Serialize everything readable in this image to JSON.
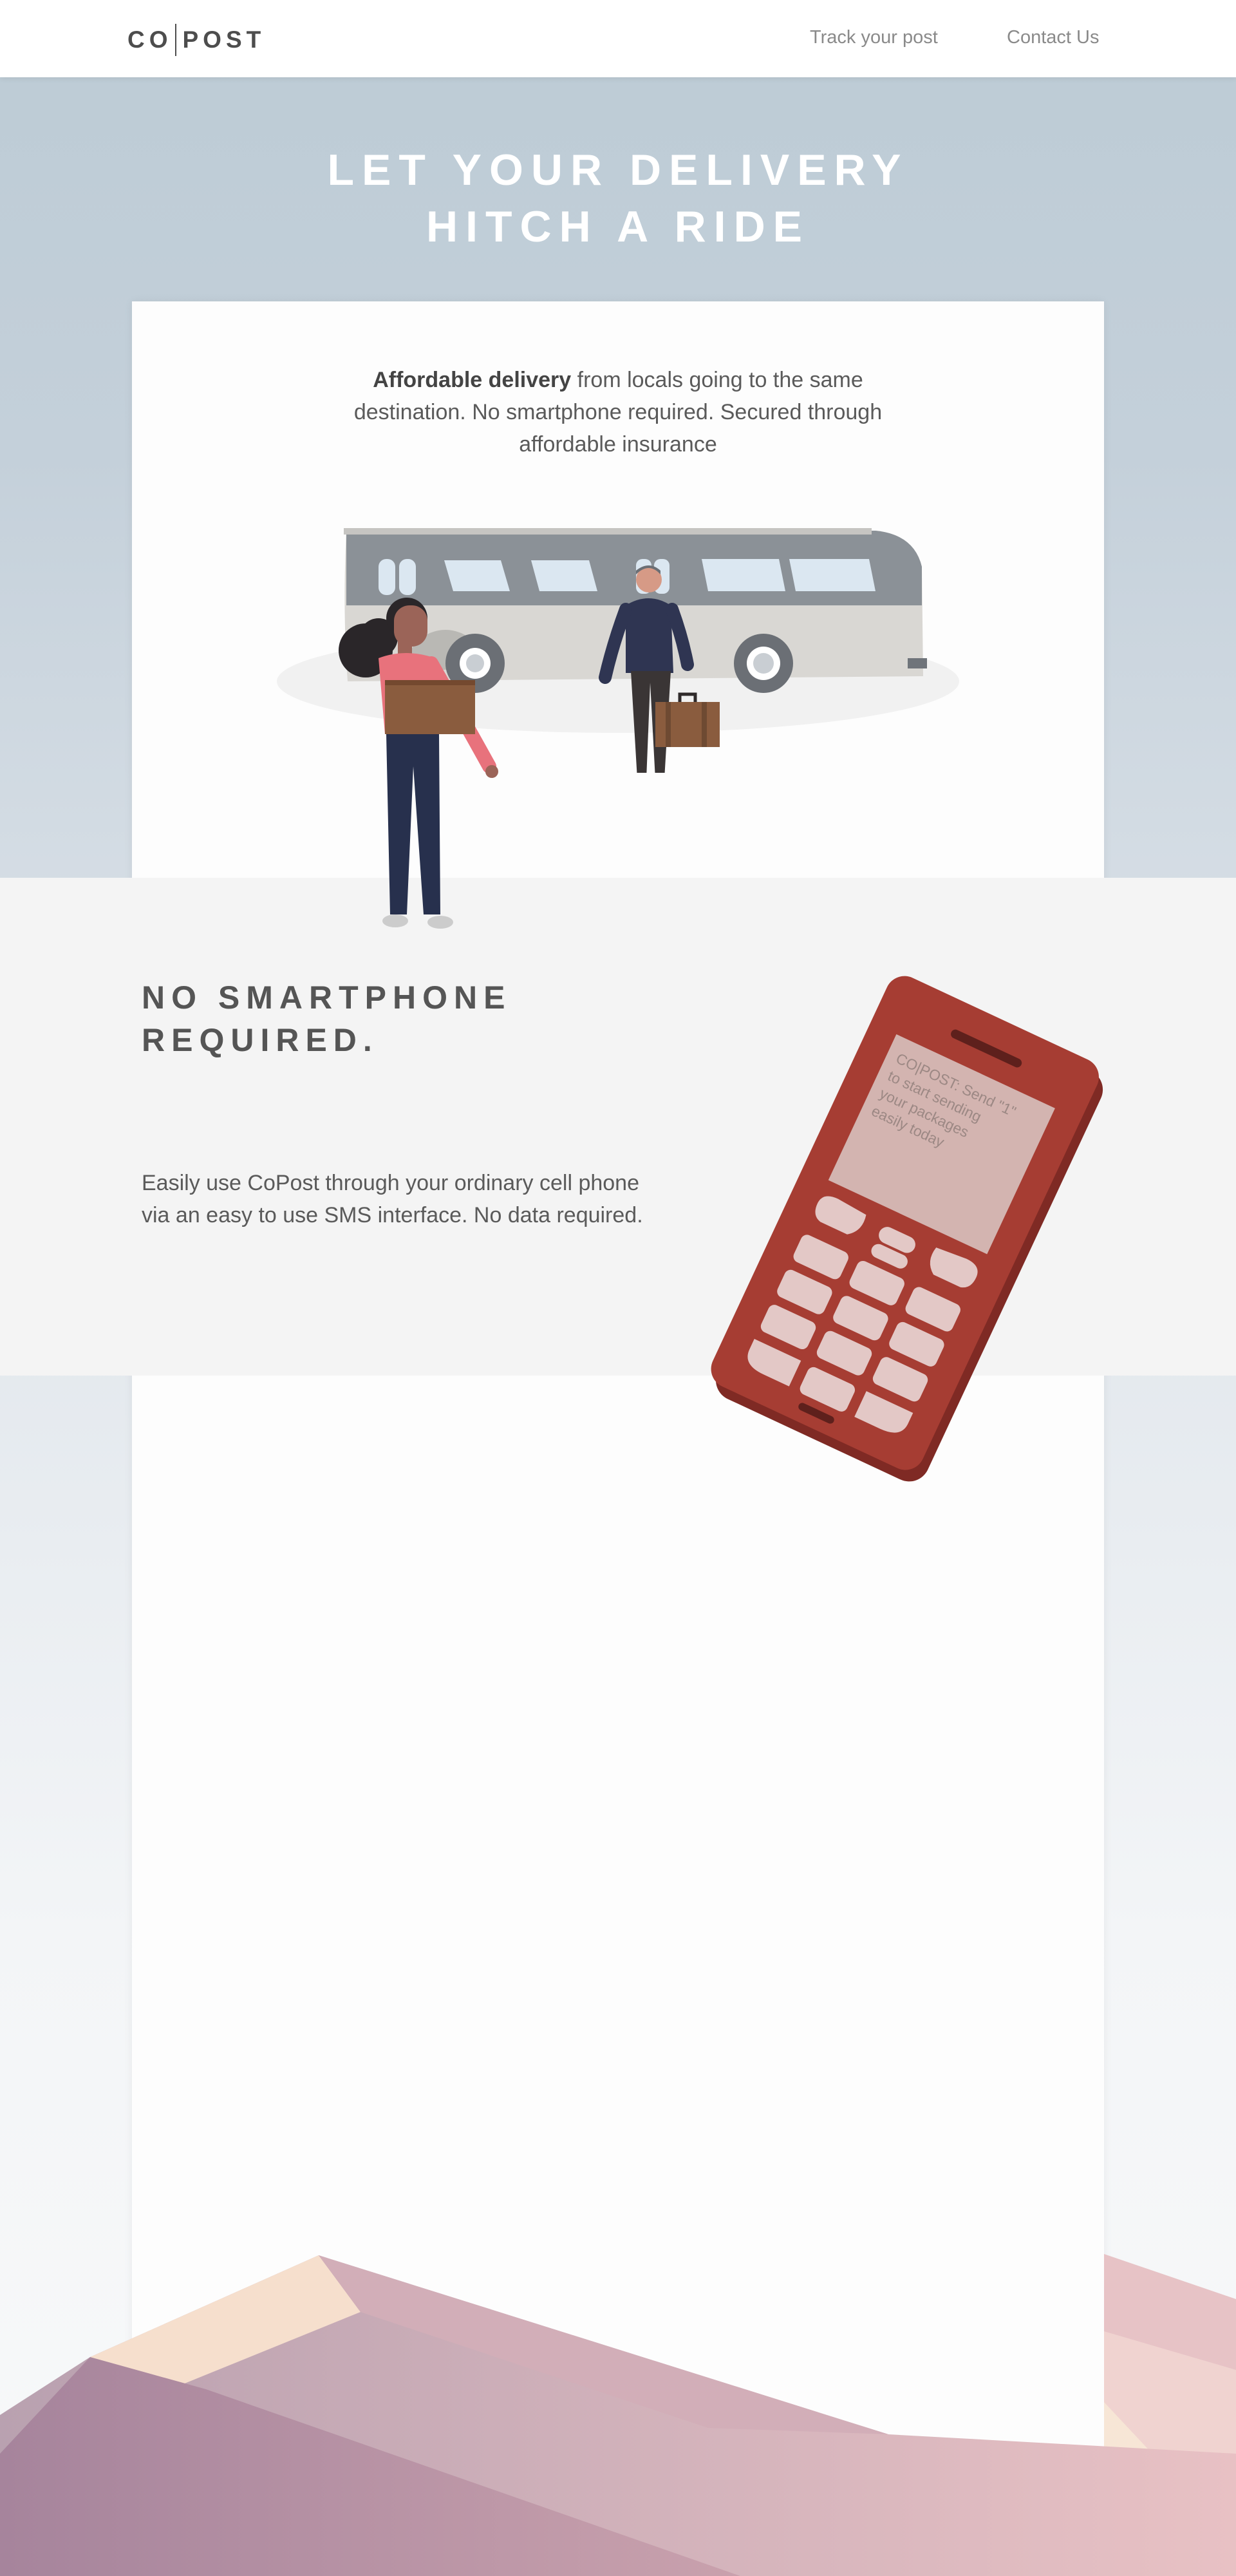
{
  "nav": {
    "logo_left": "CO",
    "logo_right": "POST",
    "links": [
      "Track your post",
      "Contact Us"
    ]
  },
  "hero": {
    "title_line1": "LET YOUR DELIVERY",
    "title_line2": "HITCH A RIDE"
  },
  "intro": {
    "bold": "Affordable delivery",
    "text": " from locals going to the same destination. No smartphone required. Secured through affordable insurance"
  },
  "feature": {
    "title_line1": "NO SMARTPHONE",
    "title_line2": "REQUIRED.",
    "text": "Easily use CoPost through your ordinary cell phone via an easy to use SMS interface. No data required.",
    "phone_screen_lines": [
      "CO|POST: Send \"1\"",
      "to start sending",
      "your packages",
      "easily today"
    ]
  },
  "colors": {
    "accent_phone": "#a63d33",
    "background_top": "#bccbd5"
  }
}
